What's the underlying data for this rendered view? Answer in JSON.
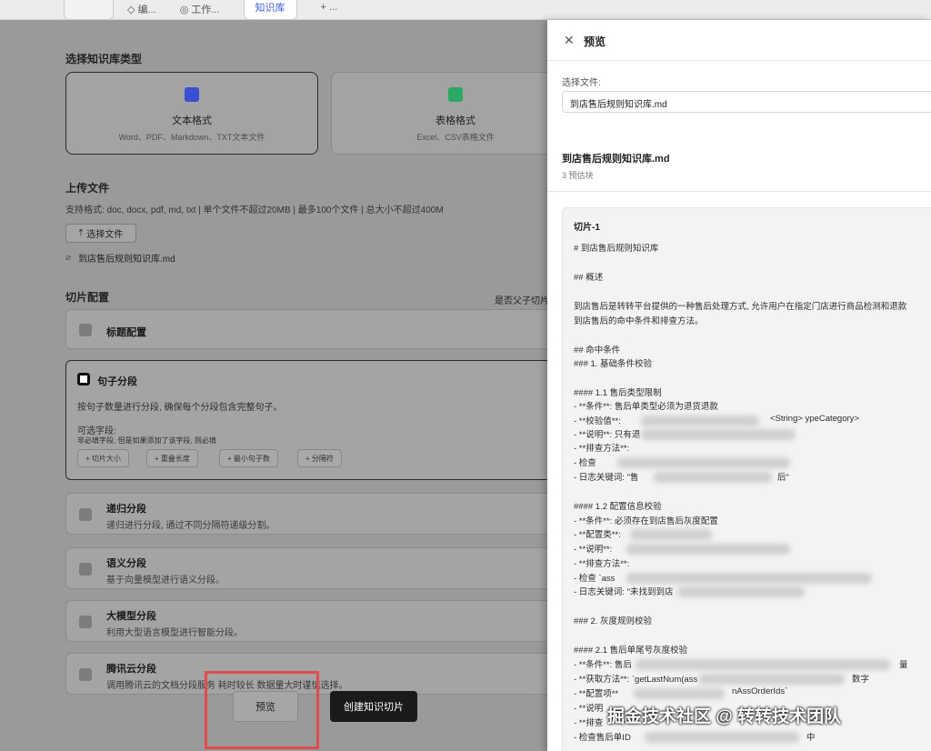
{
  "main": {
    "kb_type_title": "选择知识库类型",
    "types": [
      {
        "name": "文本格式",
        "desc": "Word、PDF、Markdown、TXT文本文件",
        "icon": "word-doc-icon",
        "color": "#3b4fd1"
      },
      {
        "name": "表格格式",
        "desc": "Excel、CSV表格文件",
        "icon": "spreadsheet-icon",
        "color": "#2aa864"
      }
    ],
    "upload_title": "上传文件",
    "upload_desc": "支持格式: doc, docx, pdf, md, txt | 单个文件不超过20MB | 最多100个文件 | 总大小不超过400M",
    "select_file_label": "选择文件",
    "uploaded_file": "到店售后规则知识库.md",
    "chunk_title": "切片配置",
    "parent_child_label": "是否父子切片",
    "chunk_options": [
      {
        "name": "标题配置",
        "desc": ""
      },
      {
        "name": "句子分段",
        "desc": "按句子数量进行分段, 确保每个分段包含完整句子。"
      },
      {
        "name": "递归分段",
        "desc": "递归进行分段, 通过不同分隔符递级分割。"
      },
      {
        "name": "语义分段",
        "desc": "基于向量模型进行语义分段。"
      },
      {
        "name": "大模型分段",
        "desc": "利用大型语言模型进行智能分段。"
      },
      {
        "name": "腾讯云分段",
        "desc": "调用腾讯云的文档分段服务 耗时较长 数据量大时谨慎选择。"
      }
    ],
    "optional_fields_label": "可选字段:",
    "optional_fields_hint": "非必填字段, 但是如果添加了该字段, 则必填",
    "field_tags": [
      "+ 切片大小",
      "+ 重叠长度",
      "+ 最小句子数",
      "+ 分隔符"
    ],
    "preview_label": "预览",
    "create_label": "创建知识切片"
  },
  "panel": {
    "title": "预览",
    "select_label": "选择文件:",
    "select_value": "到店售后规则知识库.md",
    "file_name": "到店售后规则知识库.md",
    "chunk_count": "3 预估块",
    "chunk_title": "切片-1",
    "lines": [
      "# 到店售后规则知识库",
      "## 概述",
      "到店售后是转转平台提供的一种售后处理方式, 允许用户在指定门店进行商品检测和退款",
      "到店售后的命中条件和排查方法。",
      "## 命中条件",
      "### 1. 基础条件校验",
      "#### 1.1 售后类型限制",
      "- **条件**: 售后单类型必须为退货退款",
      "- **校验值**:",
      "- **说明**: 只有退",
      "- **排查方法**:",
      "  - 检查",
      "  - 日志关键词: \"售",
      "#### 1.2 配置信息校验",
      "- **条件**: 必须存在到店售后灰度配置",
      "- **配置类**:",
      "- **说明**:",
      "- **排查方法**:",
      "  - 检查 `ass",
      "  - 日志关键词: \"未找到到店",
      "### 2. 灰度规则校验",
      "#### 2.1 售后单尾号灰度校验",
      "- **条件**: 售后",
      "- **获取方法**: `getLastNum(ass",
      "- **配置项**",
      "- **说明",
      "- **排查",
      "  - 检查售后单ID"
    ],
    "line_fragments": {
      "f1": "<String> ypeCategory>",
      "f2": "后\"",
      "f3": "nAssOrderIds`",
      "f4": "中",
      "f5": "量",
      "f6": "数字"
    }
  },
  "watermark": "掘金技术社区 @ 转转技术团队"
}
